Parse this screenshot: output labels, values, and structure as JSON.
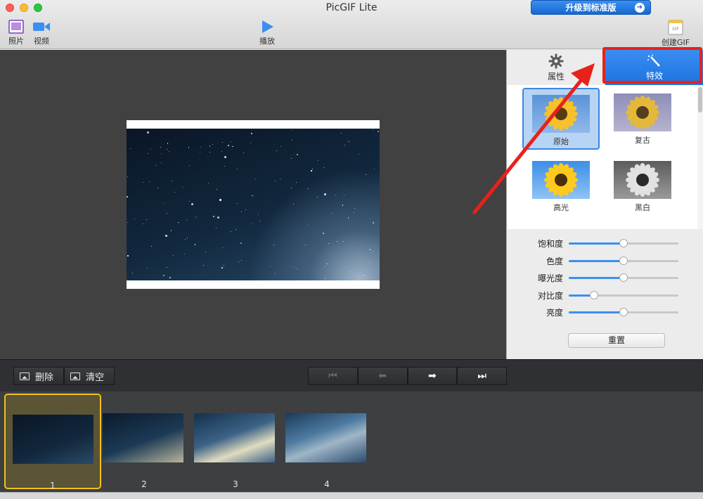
{
  "window": {
    "title": "PicGIF Lite"
  },
  "upgrade": {
    "label": "升级到标准版"
  },
  "toolbar": {
    "photo_label": "照片",
    "video_label": "视频",
    "play_label": "播放",
    "create_gif_label": "创建GIF",
    "gif_badge": "GIF"
  },
  "panel": {
    "tab_properties": "属性",
    "tab_effects": "特效",
    "effects": [
      {
        "label": "原始",
        "style": "original",
        "selected": true
      },
      {
        "label": "复古",
        "style": "vintage",
        "selected": false
      },
      {
        "label": "高光",
        "style": "highlight",
        "selected": false
      },
      {
        "label": "黑白",
        "style": "bw",
        "selected": false
      }
    ],
    "sliders": [
      {
        "label": "饱和度",
        "value": 0.5
      },
      {
        "label": "色度",
        "value": 0.5
      },
      {
        "label": "曝光度",
        "value": 0.5
      },
      {
        "label": "对比度",
        "value": 0.23
      },
      {
        "label": "亮度",
        "value": 0.5
      }
    ],
    "reset_label": "重置"
  },
  "controls": {
    "delete_label": "删除",
    "clear_label": "清空",
    "nav": [
      {
        "name": "first-frame-button",
        "glyph": "⏮",
        "enabled": false
      },
      {
        "name": "prev-frame-button",
        "glyph": "⬅",
        "enabled": false
      },
      {
        "name": "next-frame-button",
        "glyph": "➡",
        "enabled": true
      },
      {
        "name": "last-frame-button",
        "glyph": "⏭",
        "enabled": true
      }
    ]
  },
  "frames": [
    {
      "number": "1",
      "selected": true
    },
    {
      "number": "2",
      "selected": false
    },
    {
      "number": "3",
      "selected": false
    },
    {
      "number": "4",
      "selected": false
    }
  ],
  "colors": {
    "accent": "#1c74e0",
    "highlight_box": "#e8211b",
    "selected_frame": "#f0c21d"
  }
}
